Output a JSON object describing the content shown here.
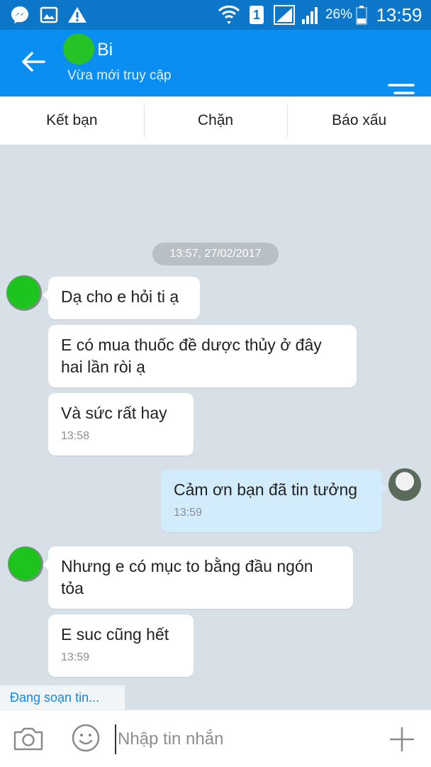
{
  "status_bar": {
    "sim_label": "1",
    "battery": "26%",
    "time": "13:59"
  },
  "header": {
    "name": "Bi",
    "status": "Vừa mới truy cập"
  },
  "actions": {
    "add_friend": "Kết bạn",
    "block": "Chặn",
    "report": "Báo xấu"
  },
  "chat": {
    "date": "13:57, 27/02/2017",
    "messages": [
      {
        "text": "Dạ cho e hỏi ti ạ",
        "time": ""
      },
      {
        "text": "E có mua thuốc đề dược thủy ở đây\nhai lần ròi ạ",
        "time": ""
      },
      {
        "text": "Và sức rất hay",
        "time": "13:58"
      },
      {
        "text": "Cảm ơn bạn đã tin tưởng",
        "time": "13:59"
      },
      {
        "text": "Nhưng e có mục to bằng đầu ngón\ntỏa",
        "time": ""
      },
      {
        "text": "E suc cũng hết",
        "time": "13:59"
      }
    ]
  },
  "typing_indicator": "Đang soạn tin...",
  "composer": {
    "placeholder": "Nhập tin nhắn"
  },
  "colors": {
    "status_bar": "#0c77c9",
    "app_bar": "#0a8ef1",
    "chat_bg": "#d7e0e6",
    "outgoing_bubble": "#d2ecfb"
  }
}
